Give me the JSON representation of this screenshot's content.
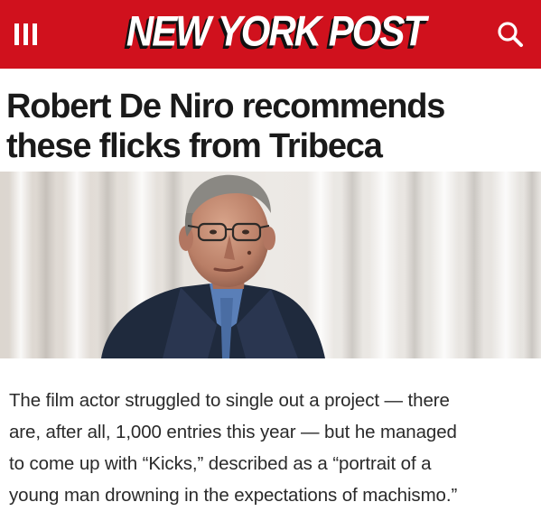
{
  "header": {
    "logo": "NEW YORK POST",
    "menu_icon": "hamburger-menu-icon",
    "search_icon": "search-icon",
    "background_color": "#d0111d"
  },
  "article": {
    "headline_lines": [
      "Robert De Niro recommends",
      "these flicks from Tribeca"
    ],
    "image": "photo of Robert De Niro in front of white curtains",
    "body_lines": [
      "The film actor struggled to single out a project — there",
      "are, after all, 1,000 entries this year — but he managed",
      "to come up with “Kicks,” described as a “portrait of a",
      "young man drowning in the expectations of machismo.”"
    ]
  }
}
